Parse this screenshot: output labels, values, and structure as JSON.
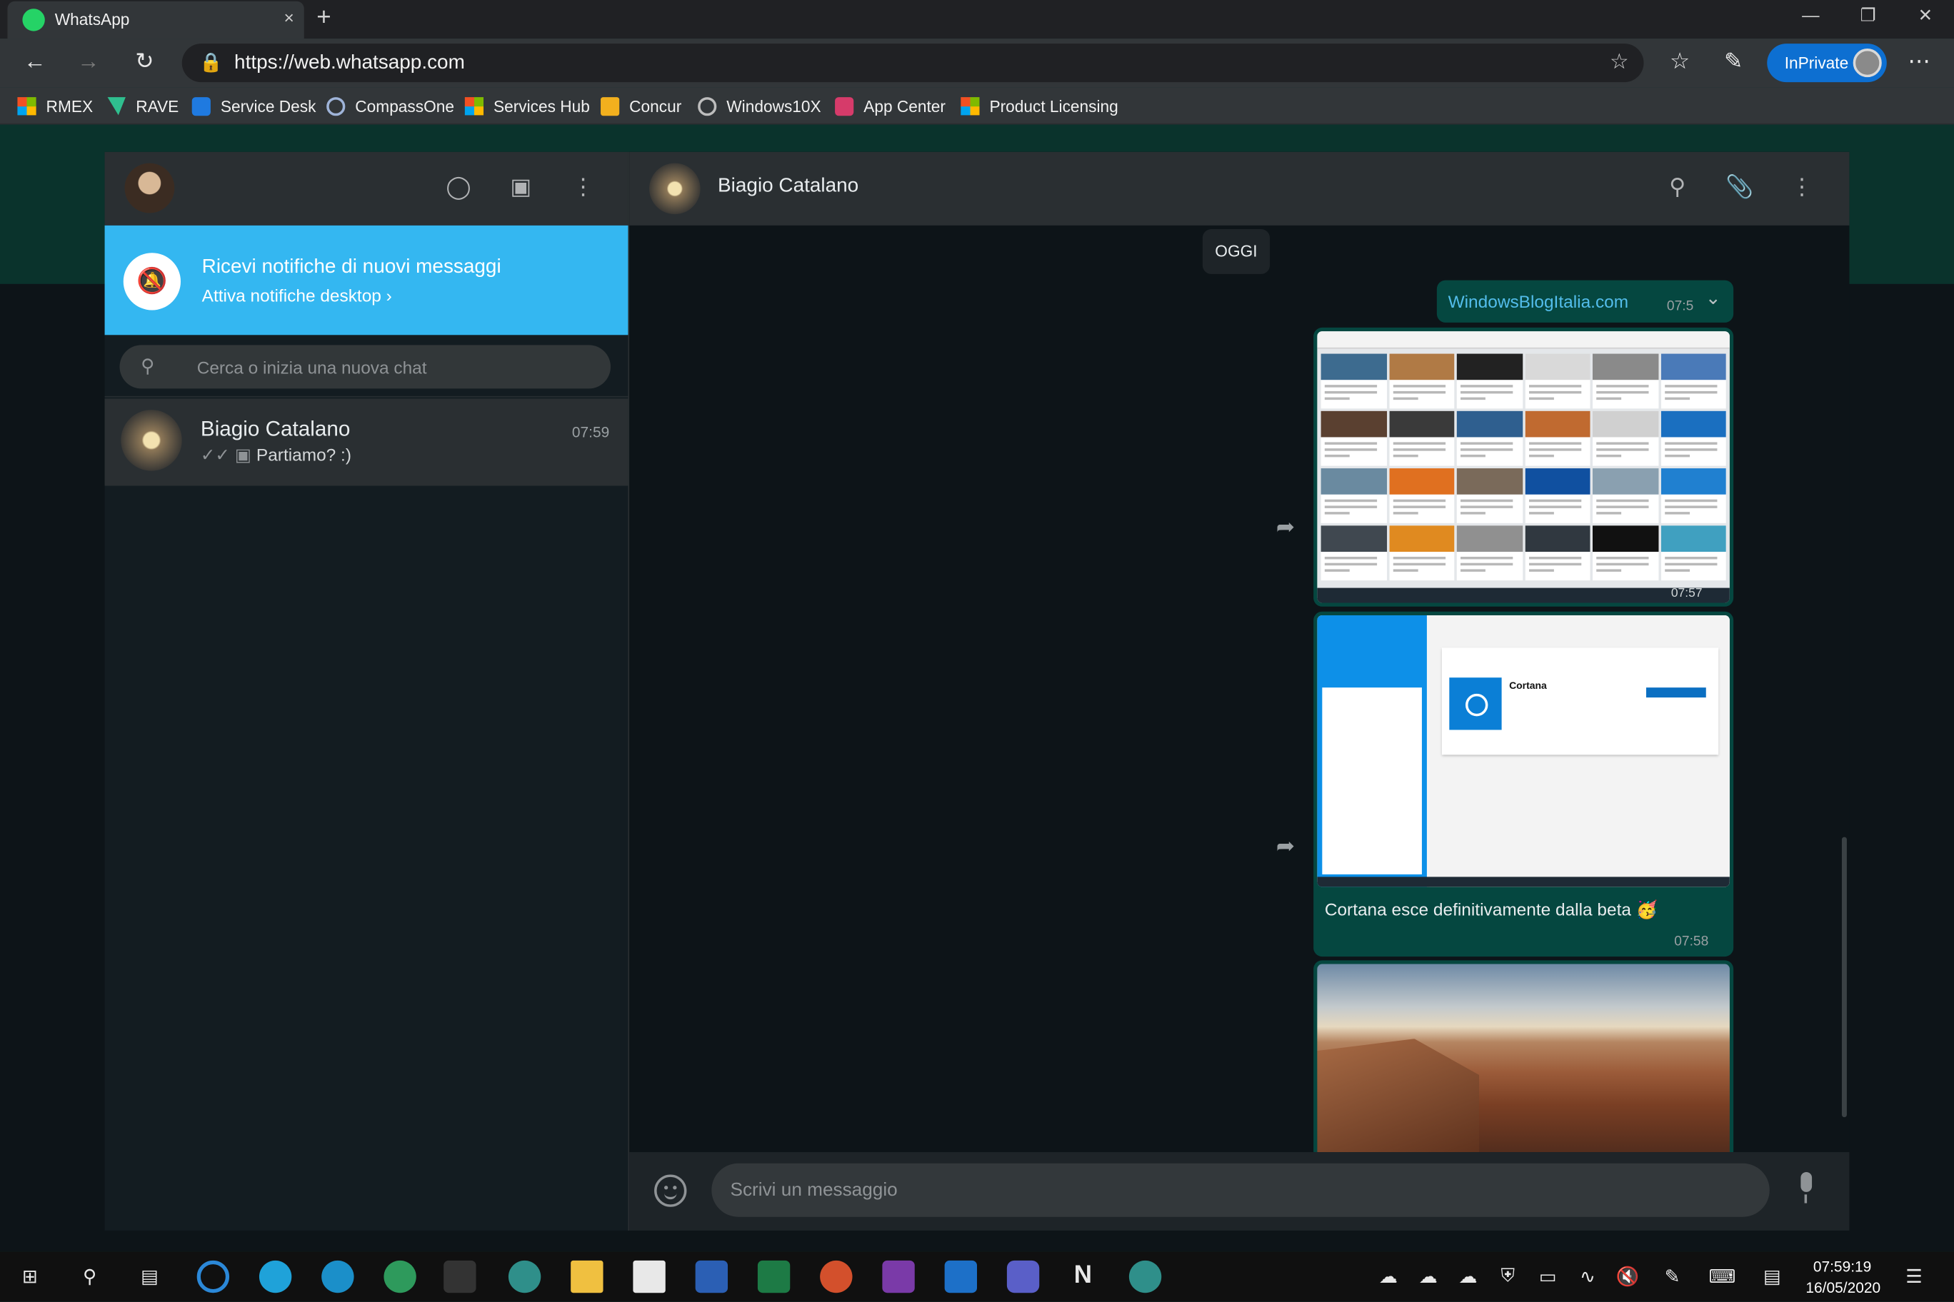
{
  "browser": {
    "tab_title": "WhatsApp",
    "close_tab": "×",
    "new_tab": "+",
    "url": "https://web.whatsapp.com",
    "inprivate_label": "InPrivate",
    "favorites": [
      "RMEX",
      "RAVE",
      "Service Desk",
      "CompassOne",
      "Services Hub",
      "Concur",
      "Windows10X",
      "App Center",
      "Product Licensing"
    ]
  },
  "sidebar": {
    "notification": {
      "title": "Ricevi notifiche di nuovi messaggi",
      "action": "Attiva notifiche desktop ›"
    },
    "search_placeholder": "Cerca o inizia una nuova chat",
    "chats": [
      {
        "name": "Biagio Catalano",
        "time": "07:59",
        "preview": "Partiamo? :)"
      }
    ]
  },
  "conversation": {
    "contact_name": "Biagio Catalano",
    "day_label": "OGGI",
    "messages": {
      "link_text": "WindowsBlogItalia.com",
      "link_time": "07:5",
      "image1_time": "07:57",
      "image2_caption": "Cortana esce definitivamente dalla beta 🥳",
      "image2_time": "07:58",
      "image2_app_title": "Cortana"
    },
    "composer_placeholder": "Scrivi un messaggio"
  },
  "taskbar": {
    "time": "07:59:19",
    "date": "16/05/2020"
  },
  "colors": {
    "accent_green": "#25d366",
    "notification_blue": "#34b7f1",
    "outgoing_bubble": "#054740",
    "link": "#53bdeb",
    "inprivate": "#0d6fd1"
  }
}
